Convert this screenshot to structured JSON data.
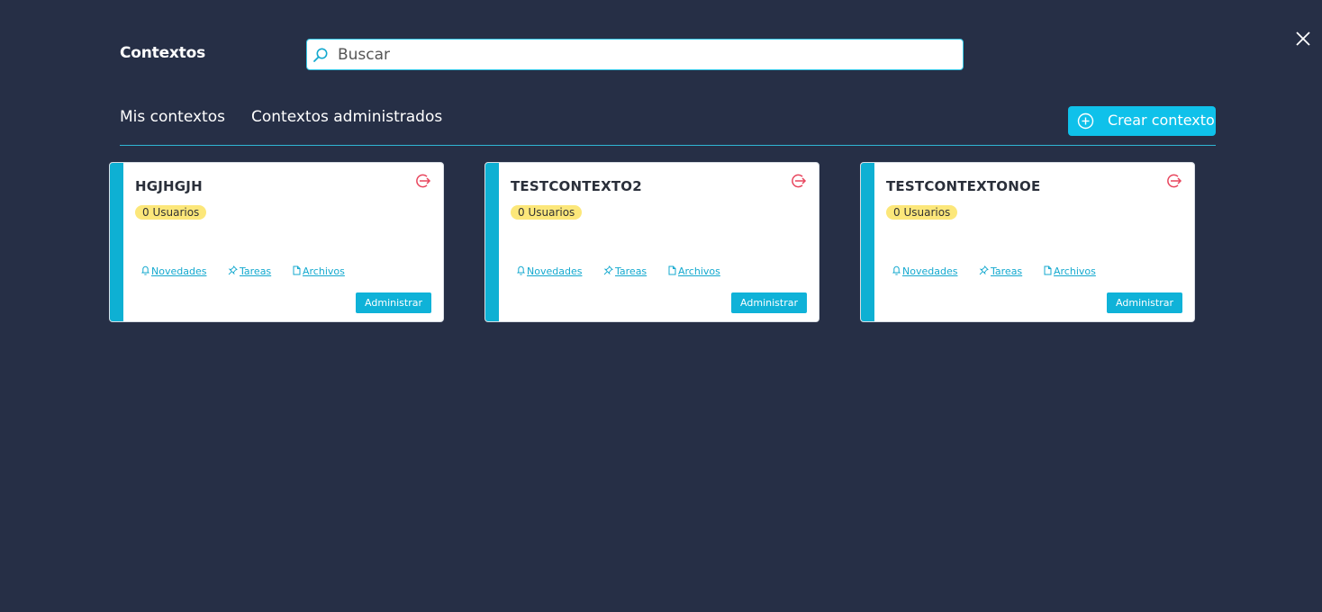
{
  "header": {
    "title": "Contextos",
    "close_icon": "close-icon"
  },
  "search": {
    "placeholder": "Buscar",
    "value": "",
    "icon": "search-icon"
  },
  "tabs": [
    {
      "label": "Mis contextos"
    },
    {
      "label": "Contextos administrados"
    }
  ],
  "create_button": {
    "label": "Crear contexto",
    "icon": "plus-circle-icon"
  },
  "colors": {
    "background": "#262f46",
    "accent": "#0fc1ea",
    "card_stripe": "#0eb0d3",
    "badge": "#fce77a",
    "exit": "#e8455d"
  },
  "cards": [
    {
      "title": "HGJHGJH",
      "users": "0 Usuarios",
      "links": {
        "news": "Novedades",
        "tasks": "Tareas",
        "files": "Archivos"
      },
      "admin_label": "Administrar"
    },
    {
      "title": "TESTCONTEXTO2",
      "users": "0 Usuarios",
      "links": {
        "news": "Novedades",
        "tasks": "Tareas",
        "files": "Archivos"
      },
      "admin_label": "Administrar"
    },
    {
      "title": "TESTCONTEXTONOE",
      "users": "0 Usuarios",
      "links": {
        "news": "Novedades",
        "tasks": "Tareas",
        "files": "Archivos"
      },
      "admin_label": "Administrar"
    }
  ]
}
